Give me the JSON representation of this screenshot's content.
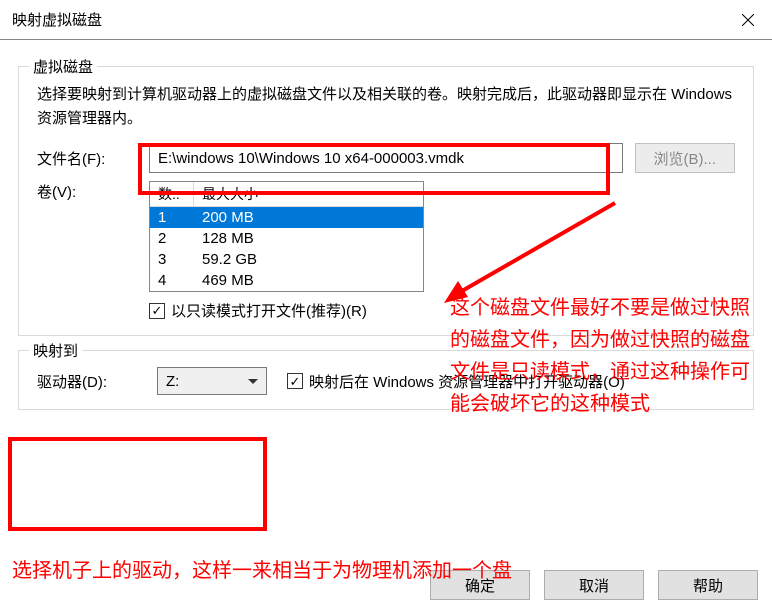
{
  "window": {
    "title": "映射虚拟磁盘"
  },
  "group_disk": {
    "title": "虚拟磁盘",
    "desc": "选择要映射到计算机驱动器上的虚拟磁盘文件以及相关联的卷。映射完成后，此驱动器即显示在 Windows 资源管理器内。",
    "file_label": "文件名(F):",
    "file_value": "E:\\windows 10\\Windows 10 x64-000003.vmdk",
    "browse_label": "浏览(B)...",
    "vol_label": "卷(V):",
    "col_num": "数..",
    "col_size": "最大大小",
    "rows": [
      {
        "num": "1",
        "size": "200 MB"
      },
      {
        "num": "2",
        "size": "128 MB"
      },
      {
        "num": "3",
        "size": "59.2 GB"
      },
      {
        "num": "4",
        "size": "469 MB"
      }
    ],
    "readonly_label": "以只读模式打开文件(推荐)(R)"
  },
  "group_map": {
    "title": "映射到",
    "drive_label": "驱动器(D):",
    "drive_value": "Z:",
    "open_explorer_label": "映射后在 Windows 资源管理器中打开驱动器(O)"
  },
  "buttons": {
    "ok": "确定",
    "cancel": "取消",
    "help": "帮助"
  },
  "annotations": {
    "note1": "这个磁盘文件最好不要是做过快照的磁盘文件，因为做过快照的磁盘文件是只读模式，通过这种操作可能会破坏它的这种模式",
    "note2": "选择机子上的驱动，这样一来相当于为物理机添加一个盘"
  }
}
